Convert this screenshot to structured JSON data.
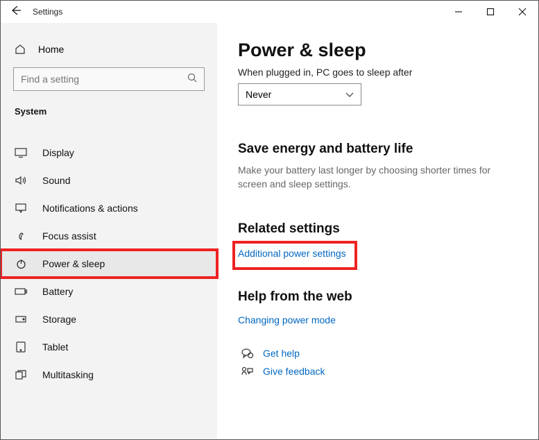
{
  "titlebar": {
    "title": "Settings"
  },
  "sidebar": {
    "home": "Home",
    "search_placeholder": "Find a setting",
    "section": "System",
    "items": [
      {
        "label": "Display"
      },
      {
        "label": "Sound"
      },
      {
        "label": "Notifications & actions"
      },
      {
        "label": "Focus assist"
      },
      {
        "label": "Power & sleep"
      },
      {
        "label": "Battery"
      },
      {
        "label": "Storage"
      },
      {
        "label": "Tablet"
      },
      {
        "label": "Multitasking"
      }
    ]
  },
  "main": {
    "title": "Power & sleep",
    "plugged_label": "When plugged in, PC goes to sleep after",
    "plugged_value": "Never",
    "energy_title": "Save energy and battery life",
    "energy_sub": "Make your battery last longer by choosing shorter times for screen and sleep settings.",
    "related_title": "Related settings",
    "related_link": "Additional power settings",
    "help_title": "Help from the web",
    "help_link": "Changing power mode",
    "get_help": "Get help",
    "give_feedback": "Give feedback"
  }
}
